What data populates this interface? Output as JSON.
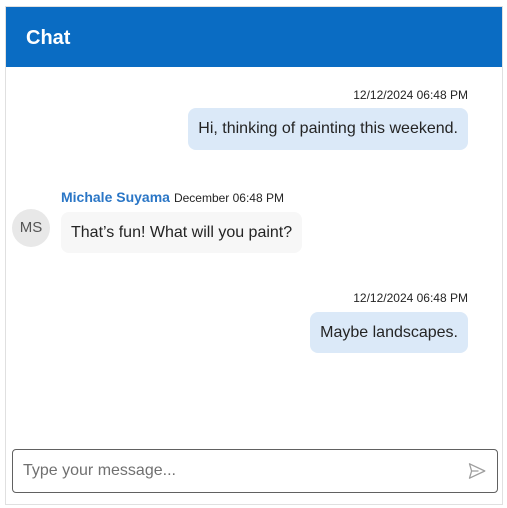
{
  "header": {
    "title": "Chat"
  },
  "messages": [
    {
      "direction": "outgoing",
      "timestamp": "12/12/2024 06:48 PM",
      "text": "Hi, thinking of painting this weekend."
    },
    {
      "direction": "incoming",
      "sender": "Michale Suyama",
      "sender_initials": "MS",
      "timestamp": "December 06:48 PM",
      "text": "That’s fun! What will you paint?"
    },
    {
      "direction": "outgoing",
      "timestamp": "12/12/2024 06:48 PM",
      "text": "Maybe landscapes."
    }
  ],
  "composer": {
    "placeholder": "Type your message...",
    "value": "",
    "send_icon": "send-icon"
  },
  "colors": {
    "header_bg": "#0a6cc3",
    "outgoing_bubble": "#dbe9f8",
    "incoming_bubble": "#f7f7f7",
    "sender_name": "#2a76c6"
  }
}
